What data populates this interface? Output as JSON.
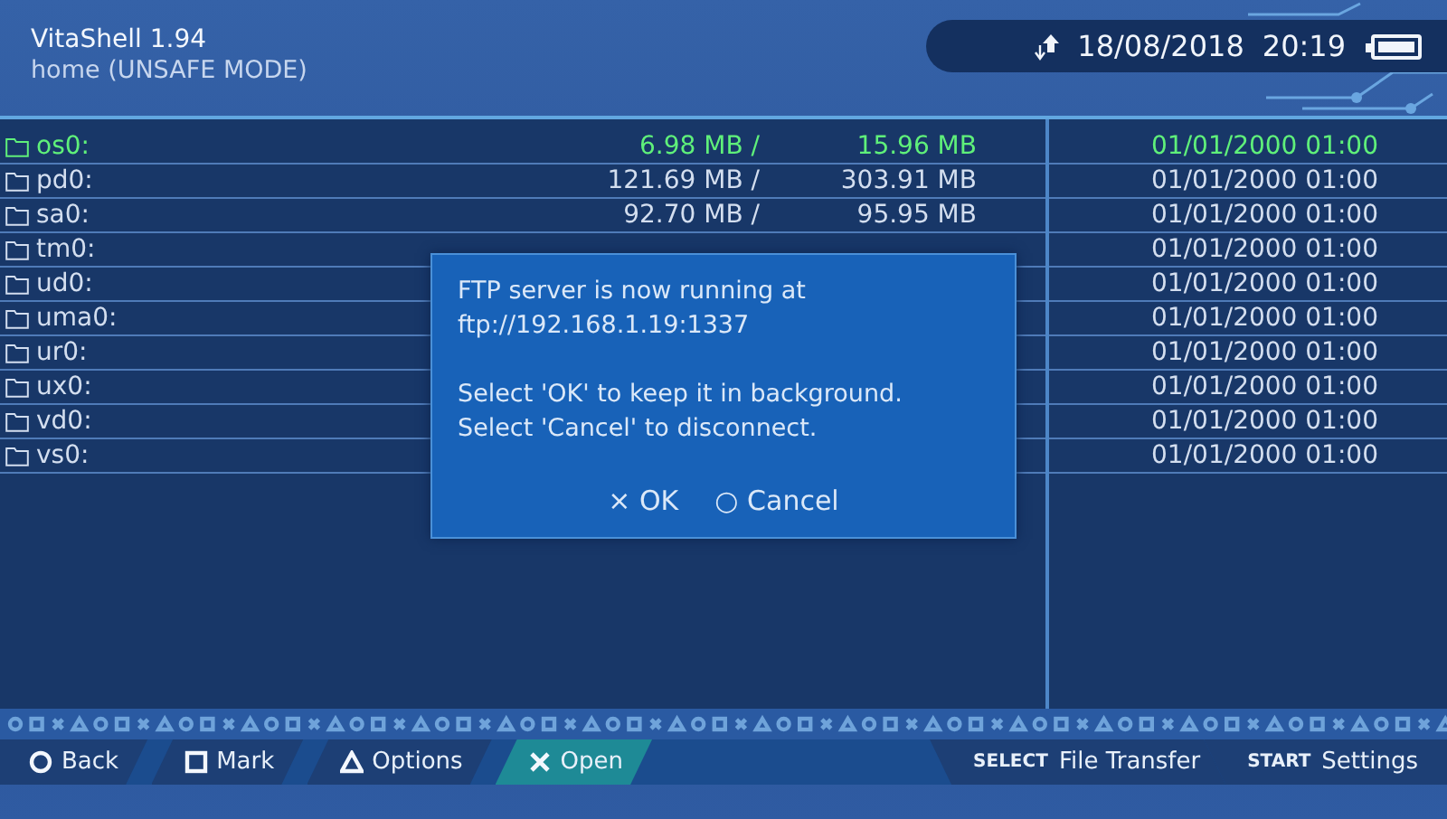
{
  "header": {
    "title": "VitaShell 1.94",
    "subtitle": "home (UNSAFE MODE)",
    "status": {
      "date": "18/08/2018",
      "time": "20:19"
    }
  },
  "files": [
    {
      "name": "os0:",
      "used": "6.98 MB",
      "separator": "/",
      "total": "15.96 MB",
      "date": "01/01/2000 01:00",
      "selected": true
    },
    {
      "name": "pd0:",
      "used": "121.69 MB",
      "separator": "/",
      "total": "303.91 MB",
      "date": "01/01/2000 01:00",
      "selected": false
    },
    {
      "name": "sa0:",
      "used": "92.70 MB",
      "separator": "/",
      "total": "95.95 MB",
      "date": "01/01/2000 01:00",
      "selected": false
    },
    {
      "name": "tm0:",
      "date": "01/01/2000 01:00",
      "selected": false
    },
    {
      "name": "ud0:",
      "date": "01/01/2000 01:00",
      "selected": false
    },
    {
      "name": "uma0:",
      "date": "01/01/2000 01:00",
      "selected": false
    },
    {
      "name": "ur0:",
      "date": "01/01/2000 01:00",
      "selected": false
    },
    {
      "name": "ux0:",
      "date": "01/01/2000 01:00",
      "selected": false
    },
    {
      "name": "vd0:",
      "date": "01/01/2000 01:00",
      "selected": false
    },
    {
      "name": "vs0:",
      "date": "01/01/2000 01:00",
      "selected": false
    }
  ],
  "dialog": {
    "paragraphs": [
      [
        "FTP server is now running at",
        "ftp://192.168.1.19:1337"
      ],
      [
        "Select 'OK' to keep it in background.",
        "Select 'Cancel' to disconnect."
      ]
    ],
    "buttons": [
      {
        "icon": "×",
        "label": "OK"
      },
      {
        "icon": "○",
        "label": "Cancel"
      }
    ]
  },
  "footer": {
    "actions": [
      {
        "kind": "circle",
        "label": "Back",
        "selected": false
      },
      {
        "kind": "square",
        "label": "Mark",
        "selected": false
      },
      {
        "kind": "triangle",
        "label": "Options",
        "selected": false
      },
      {
        "kind": "cross",
        "label": "Open",
        "selected": true
      }
    ],
    "shortcuts": [
      {
        "key": "SELECT",
        "label": "File Transfer"
      },
      {
        "key": "START",
        "label": "Settings"
      }
    ]
  }
}
